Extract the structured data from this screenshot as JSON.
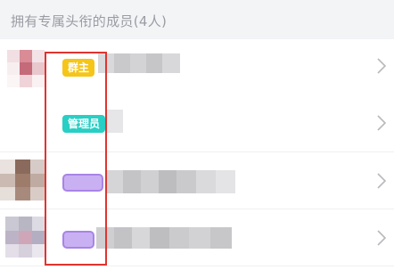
{
  "header": {
    "title": "拥有专属头衔的成员(4人)"
  },
  "members": [
    {
      "badge_label": "群主",
      "badge_kind": "owner"
    },
    {
      "badge_label": "管理员",
      "badge_kind": "admin"
    },
    {
      "badge_label": "",
      "badge_kind": "custom"
    },
    {
      "badge_label": "",
      "badge_kind": "custom"
    }
  ],
  "colors": {
    "owner_badge": "#f5c518",
    "admin_badge": "#28cfc4",
    "custom_badge": "#c9b0f2",
    "highlight": "#e0342f"
  },
  "icons": {
    "row_arrow": "chevron-right-icon"
  }
}
